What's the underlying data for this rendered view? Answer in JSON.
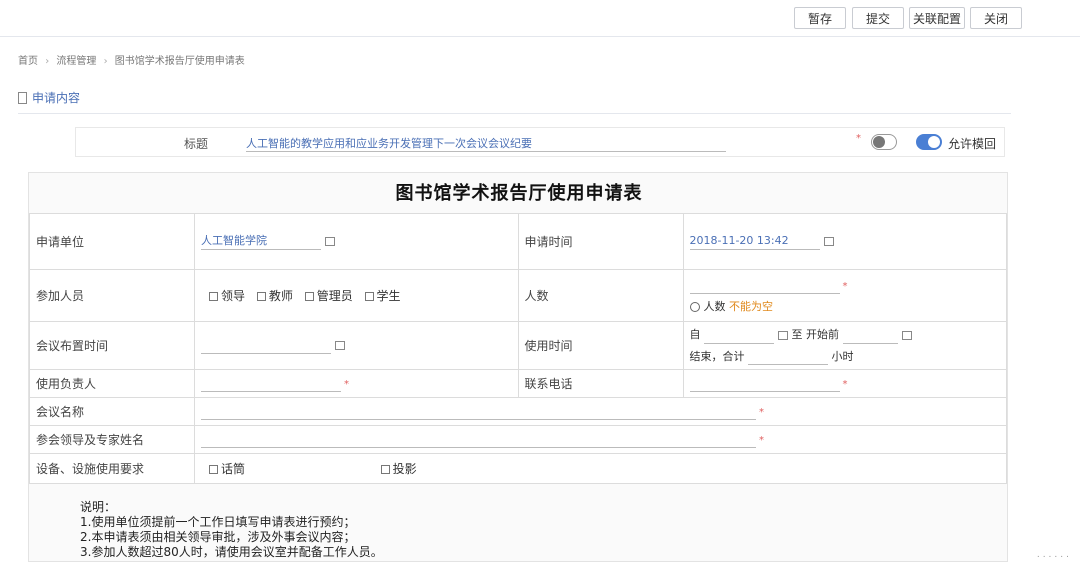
{
  "toolbar": {
    "buttons": [
      "暂存",
      "提交",
      "关联配置",
      "关闭"
    ]
  },
  "breadcrumb": [
    "首页",
    "流程管理",
    "图书馆学术报告厅使用申请表"
  ],
  "section": {
    "title": "申请内容"
  },
  "subject": {
    "label": "标题",
    "value": "人工智能的教学应用和应业务开发管理下一次会议会议纪要",
    "toggle_label": "允许模回"
  },
  "form": {
    "title": "图书馆学术报告厅使用申请表",
    "apply_unit": {
      "label": "申请单位",
      "value": "人工智能学院"
    },
    "apply_time": {
      "label": "申请时间",
      "value": "2018-11-20 13:42"
    },
    "participants": {
      "label": "参加人员",
      "options": [
        "领导",
        "教师",
        "管理员",
        "学生"
      ]
    },
    "count": {
      "label": "人数",
      "hint_prefix": "人数",
      "hint_warn": "不能为空"
    },
    "layout_time": {
      "label": "会议布置时间"
    },
    "use_time": {
      "label": "使用时间",
      "from_label": "自",
      "to_label": "至",
      "start_label": "开始前",
      "end_label": "结束，合计",
      "hours_label": "小时"
    },
    "person_in_charge": {
      "label": "使用负责人"
    },
    "phone": {
      "label": "联系电话"
    },
    "meeting_name": {
      "label": "会议名称"
    },
    "leaders": {
      "label": "参会领导及专家姓名"
    },
    "equipment": {
      "label": "设备、设施使用要求",
      "opt1": "话筒",
      "opt2": "投影"
    }
  },
  "notes": {
    "title": "说明：",
    "items": [
      "1.使用单位须提前一个工作日填写申请表进行预约；",
      "2.本申请表须由相关领导审批，涉及外事会议内容；",
      "3.参加人数超过80人时，请使用会议室并配备工作人员。"
    ]
  }
}
